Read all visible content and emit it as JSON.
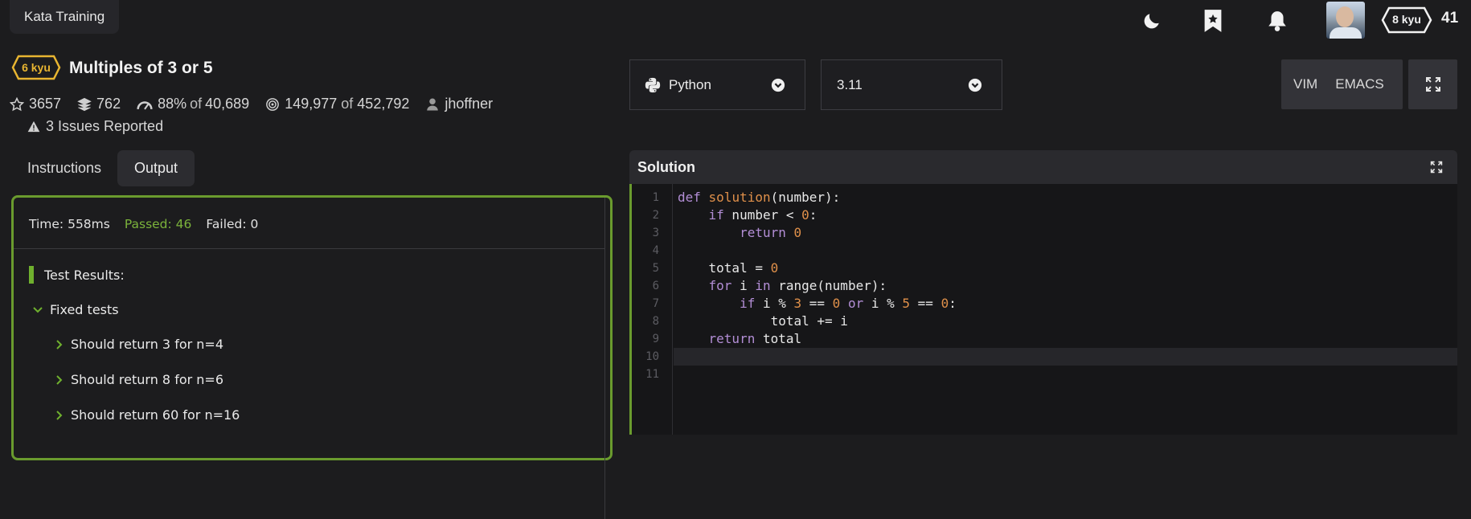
{
  "header": {
    "tab_label": "Kata Training",
    "icons": [
      "moon-icon",
      "bookmark-star-icon",
      "bell-icon"
    ],
    "rank_badge": "8 kyu",
    "honor": "41"
  },
  "kata": {
    "kyu": "6 kyu",
    "title": "Multiples of 3 or 5",
    "stars": "3657",
    "collections": "762",
    "satisfaction_pct": "88%",
    "satisfaction_of": "of",
    "satisfaction_votes": "40,689",
    "completed": "149,977",
    "completed_of": "of",
    "attempted": "452,792",
    "author": "jhoffner",
    "issues": "3 Issues Reported"
  },
  "left_tabs": {
    "instructions": "Instructions",
    "output": "Output"
  },
  "output": {
    "time": "Time: 558ms",
    "passed": "Passed: 46",
    "failed": "Failed: 0",
    "results_heading": "Test Results:",
    "group": "Fixed tests",
    "tests": [
      "Should return 3 for n=4",
      "Should return 8 for n=6",
      "Should return 60 for n=16"
    ]
  },
  "editor_controls": {
    "language": "Python",
    "version": "3.11",
    "mode_vim": "VIM",
    "mode_emacs": "EMACS"
  },
  "solution": {
    "heading": "Solution",
    "line_numbers": [
      "1",
      "2",
      "3",
      "4",
      "5",
      "6",
      "7",
      "8",
      "9",
      "10",
      "11"
    ],
    "lines": [
      "def solution(number):",
      "    if number < 0:",
      "        return 0",
      "",
      "    total = 0",
      "    for i in range(number):",
      "        if i % 3 == 0 or i % 5 == 0:",
      "            total += i",
      "    return total",
      "",
      ""
    ],
    "active_line": 10
  },
  "colors": {
    "accent_green": "#6fb02e",
    "kyu_yellow": "#e8b531",
    "keyword": "#b38ed6",
    "number": "#e0904a"
  }
}
